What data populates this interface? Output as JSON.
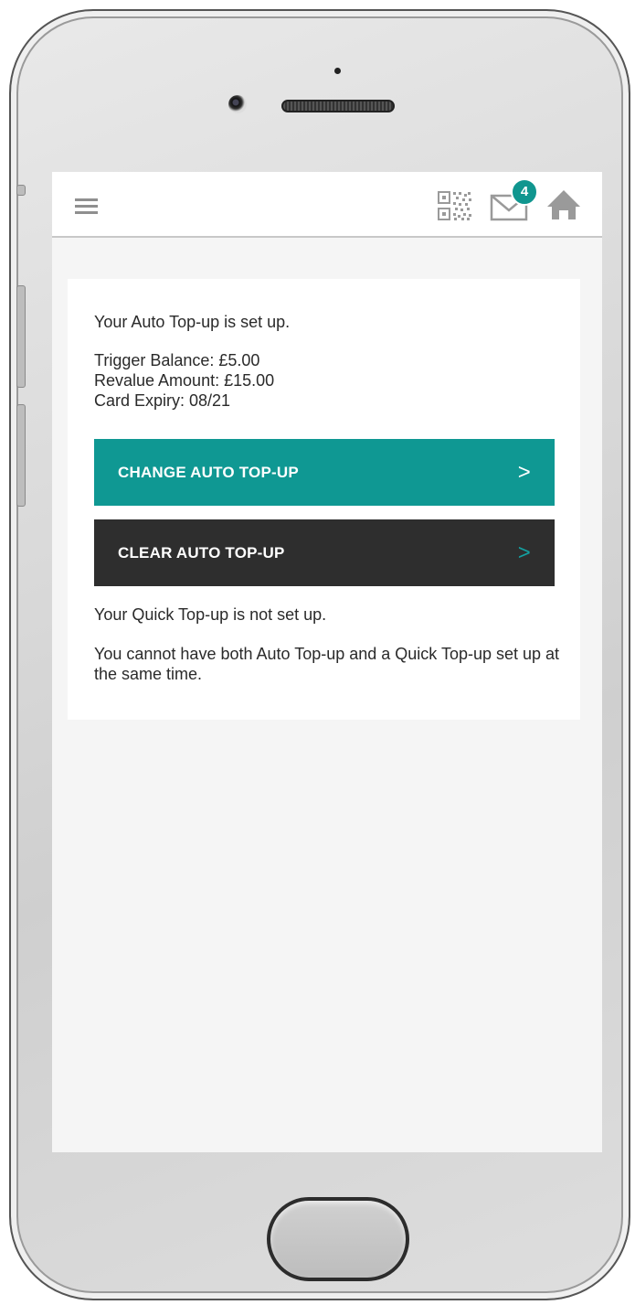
{
  "header": {
    "menu_icon": "hamburger-menu-icon",
    "qr_icon": "qr-code-icon",
    "mail_icon": "envelope-icon",
    "mail_badge": "4",
    "home_icon": "home-icon"
  },
  "auto_topup": {
    "status_text": "Your Auto Top-up is set up.",
    "trigger_balance": "Trigger Balance: £5.00",
    "revalue_amount": "Revalue Amount: £15.00",
    "card_expiry": "Card Expiry: 08/21",
    "change_button_label": "CHANGE AUTO TOP-UP",
    "clear_button_label": "CLEAR AUTO TOP-UP",
    "chevron": ">"
  },
  "quick_topup": {
    "status_text": "Your Quick Top-up is not set up.",
    "note": "You cannot have both Auto Top-up and a Quick Top-up set up at the same time."
  },
  "colors": {
    "accent": "#0f9893",
    "dark_button": "#2e2e2e",
    "background": "#f5f5f5"
  }
}
